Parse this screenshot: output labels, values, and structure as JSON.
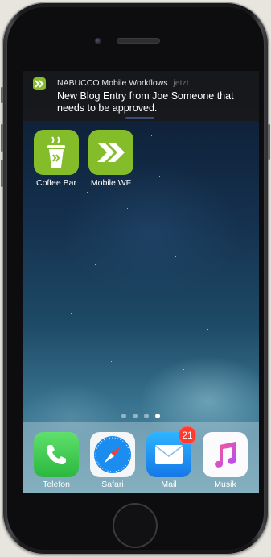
{
  "notification": {
    "app_name": "NABUCCO Mobile Workflows",
    "time": "jetzt",
    "message": "New Blog Entry from Joe Someone that needs to be approved.",
    "accent_color": "#84bc2a"
  },
  "home_apps": [
    {
      "label": "Coffee Bar",
      "icon": "coffee-cup-icon"
    },
    {
      "label": "Mobile WF",
      "icon": "chevron-forward-icon"
    }
  ],
  "page_indicator": {
    "count": 4,
    "active_index": 3
  },
  "dock_apps": [
    {
      "label": "Telefon",
      "icon": "phone-icon"
    },
    {
      "label": "Safari",
      "icon": "compass-icon"
    },
    {
      "label": "Mail",
      "icon": "envelope-icon",
      "badge": "21"
    },
    {
      "label": "Musik",
      "icon": "music-note-icon"
    }
  ]
}
